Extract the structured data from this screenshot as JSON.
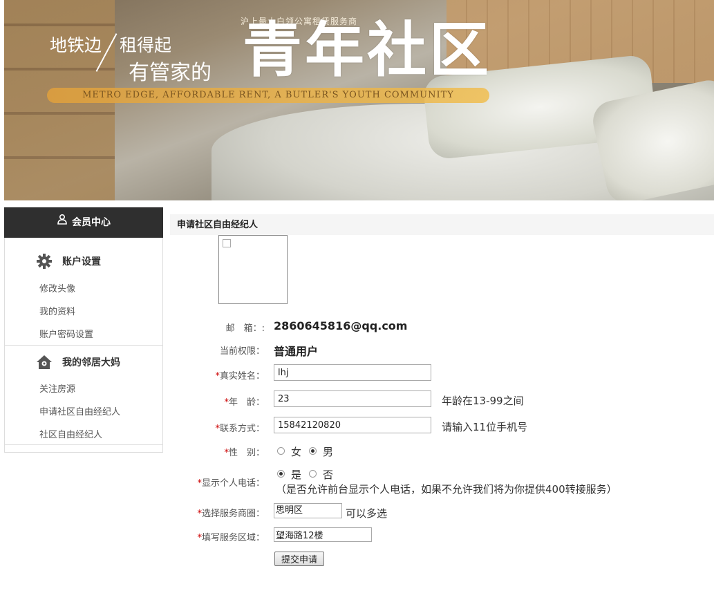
{
  "banner": {
    "tagline_small": "沪上最大白领公寓租赁服务商",
    "tagline_a": "地铁边",
    "tagline_a2": "租得起",
    "tagline_b": "有管家的",
    "title": "青年社区",
    "subtitle_en": "METRO EDGE, AFFORDABLE RENT, A BUTLER'S YOUTH COMMUNITY"
  },
  "sidebar": {
    "header": "会员中心",
    "sections": [
      {
        "title": "账户设置",
        "icon": "gear-icon",
        "items": [
          "修改头像",
          "我的资料",
          "账户密码设置"
        ]
      },
      {
        "title": "我的邻居大妈",
        "icon": "house-icon",
        "items": [
          "关注房源",
          "申请社区自由经纪人",
          "社区自由经纪人"
        ]
      }
    ]
  },
  "main": {
    "title": "申请社区自由经纪人",
    "form": {
      "email_label": "邮　箱：:",
      "email_value": "2860645816@qq.com",
      "permission_label": "当前权限：",
      "permission_value": "普通用户",
      "realname_label": "真实姓名：",
      "realname_value": "lhj",
      "age_label": "年　龄：",
      "age_value": "23",
      "age_hint": "年龄在13-99之间",
      "contact_label": "联系方式：",
      "contact_value": "15842120820",
      "contact_hint": "请输入11位手机号",
      "gender_label": "性　别：",
      "gender_options": [
        "女",
        "男"
      ],
      "gender_selected": "男",
      "show_phone_label": "显示个人电话：",
      "show_phone_options": [
        "是",
        "否"
      ],
      "show_phone_selected": "是",
      "show_phone_note": "（是否允许前台显示个人电话，如果不允许我们将为你提供400转接服务）",
      "district_label": "选择服务商圈：",
      "district_value": "思明区",
      "district_hint": "可以多选",
      "area_label": "填写服务区域：",
      "area_value": "望海路12楼",
      "required_mark": "*",
      "submit_label": "提交申请"
    }
  }
}
